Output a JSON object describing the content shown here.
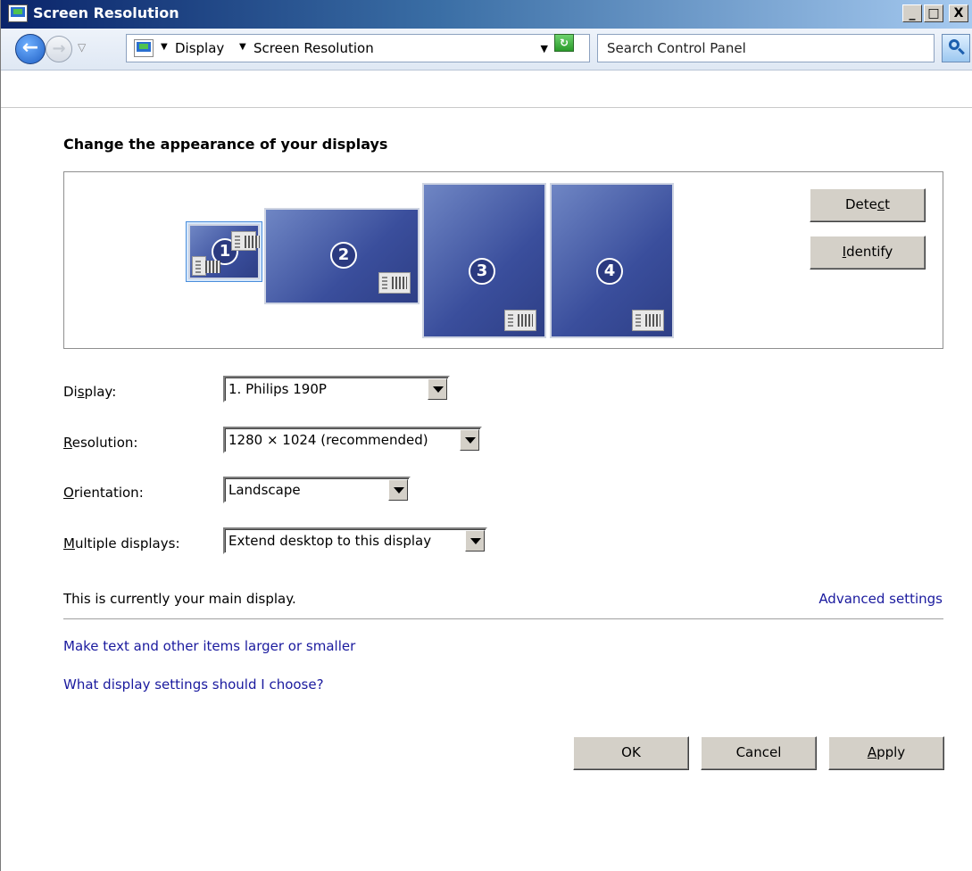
{
  "window": {
    "title": "Screen Resolution",
    "controls": {
      "minimize": "_",
      "maximize": "□",
      "close": "X"
    }
  },
  "navigation": {
    "breadcrumb": [
      "Display",
      "Screen Resolution"
    ],
    "search_placeholder": "Search Control Panel"
  },
  "main": {
    "heading": "Change the appearance of your displays",
    "monitors": [
      {
        "number": "1",
        "selected": true
      },
      {
        "number": "2",
        "selected": false
      },
      {
        "number": "3",
        "selected": false
      },
      {
        "number": "4",
        "selected": false
      }
    ],
    "detect_button": {
      "pre": "Dete",
      "accel": "c",
      "post": "t"
    },
    "identify_button": {
      "pre": "",
      "accel": "I",
      "post": "dentify"
    },
    "fields": {
      "display": {
        "label_pre": "Di",
        "label_accel": "s",
        "label_post": "play:",
        "value": "1. Philips 190P"
      },
      "resolution": {
        "label_pre": "",
        "label_accel": "R",
        "label_post": "esolution:",
        "value": "1280 × 1024 (recommended)"
      },
      "orientation": {
        "label_pre": "",
        "label_accel": "O",
        "label_post": "rientation:",
        "value": "Landscape"
      },
      "multiple_displays": {
        "label_pre": "",
        "label_accel": "M",
        "label_post": "ultiple displays:",
        "value": "Extend desktop to this display"
      }
    },
    "status": "This is currently your main display.",
    "advanced_settings_link": "Advanced settings",
    "links": [
      "Make text and other items larger or smaller",
      "What display settings should I choose?"
    ]
  },
  "buttons": {
    "ok": "OK",
    "cancel": "Cancel",
    "apply": {
      "pre": "",
      "accel": "A",
      "post": "pply"
    }
  },
  "colors": {
    "title_bar": "#0a246a",
    "link": "#1a1a9e",
    "monitor": "#3a4e9c",
    "button_face": "#d4d0c8"
  }
}
